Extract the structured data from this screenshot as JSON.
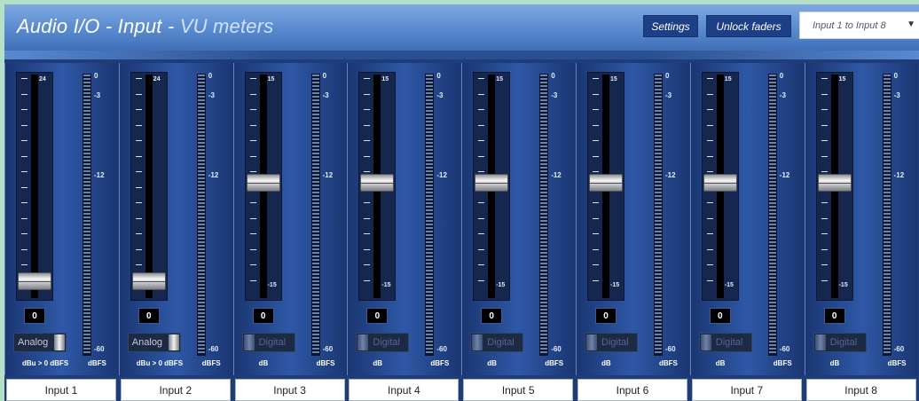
{
  "header": {
    "title_main": "Audio I/O - Input - ",
    "title_accent": "VU meters",
    "settings_label": "Settings",
    "unlock_label": "Unlock faders",
    "range_select": "Input 1 to Input 8",
    "dropdown_icon": "chevron-down-icon",
    "colors": {
      "header": "#5f8fd2",
      "panel": "#1f3c76",
      "button": "#1c3f86"
    }
  },
  "channels": [
    {
      "name": "Input 1",
      "fader_top_label": "24",
      "fader_bottom_label": "",
      "fader_level": 0.02,
      "value": "0",
      "mode": "Analog",
      "mode_on": true,
      "unit": "dBu > 0 dBFS",
      "vu_unit": "dBFS"
    },
    {
      "name": "Input 2",
      "fader_top_label": "24",
      "fader_bottom_label": "",
      "fader_level": 0.02,
      "value": "0",
      "mode": "Analog",
      "mode_on": true,
      "unit": "dBu > 0 dBFS",
      "vu_unit": "dBFS"
    },
    {
      "name": "Input 3",
      "fader_top_label": "15",
      "fader_bottom_label": "-15",
      "fader_level": 0.5,
      "value": "0",
      "mode": "Digital",
      "mode_on": false,
      "unit": "dB",
      "vu_unit": "dBFS"
    },
    {
      "name": "Input 4",
      "fader_top_label": "15",
      "fader_bottom_label": "-15",
      "fader_level": 0.5,
      "value": "0",
      "mode": "Digital",
      "mode_on": false,
      "unit": "dB",
      "vu_unit": "dBFS"
    },
    {
      "name": "Input 5",
      "fader_top_label": "15",
      "fader_bottom_label": "-15",
      "fader_level": 0.5,
      "value": "0",
      "mode": "Digital",
      "mode_on": false,
      "unit": "dB",
      "vu_unit": "dBFS"
    },
    {
      "name": "Input 6",
      "fader_top_label": "15",
      "fader_bottom_label": "-15",
      "fader_level": 0.5,
      "value": "0",
      "mode": "Digital",
      "mode_on": false,
      "unit": "dB",
      "vu_unit": "dBFS"
    },
    {
      "name": "Input 7",
      "fader_top_label": "15",
      "fader_bottom_label": "-15",
      "fader_level": 0.5,
      "value": "0",
      "mode": "Digital",
      "mode_on": false,
      "unit": "dB",
      "vu_unit": "dBFS"
    },
    {
      "name": "Input 8",
      "fader_top_label": "15",
      "fader_bottom_label": "-15",
      "fader_level": 0.5,
      "value": "0",
      "mode": "Digital",
      "mode_on": false,
      "unit": "dB",
      "vu_unit": "dBFS"
    }
  ],
  "vu_scale": [
    "0",
    "-3",
    "-12",
    "-60"
  ]
}
